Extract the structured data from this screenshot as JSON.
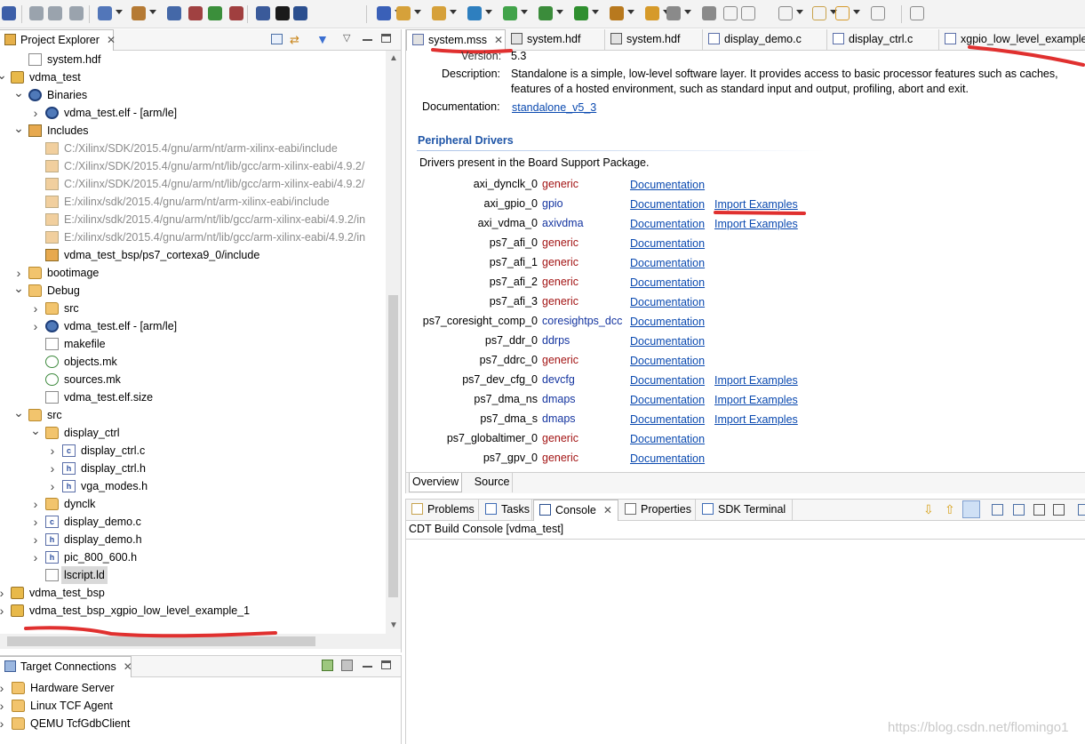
{
  "toolbar": {
    "icons": [
      "save-icon",
      "save-all-icon",
      "print-icon",
      "debug-config-icon",
      "build-icon",
      "hardware-icon",
      "program-fpga-icon",
      "xsct-icon",
      "launch-icon",
      "terminal-icon",
      "new-wizard-icon",
      "open-type-icon",
      "search-icon",
      "run-icon",
      "debug-icon",
      "external-tools-icon",
      "back-icon",
      "forward-icon",
      "open-perspective-icon"
    ]
  },
  "project_explorer": {
    "title": "Project Explorer",
    "rows": [
      {
        "label": "system.hdf",
        "indent": 1,
        "icon": "file",
        "twisty": ""
      },
      {
        "label": "vdma_test",
        "indent": 0,
        "icon": "project",
        "twisty": "open"
      },
      {
        "label": "Binaries",
        "indent": 1,
        "icon": "binaries",
        "twisty": "open"
      },
      {
        "label": "vdma_test.elf - [arm/le]",
        "indent": 2,
        "icon": "gear",
        "twisty": "closed"
      },
      {
        "label": "Includes",
        "indent": 1,
        "icon": "includes",
        "twisty": "open"
      },
      {
        "label": "C:/Xilinx/SDK/2015.4/gnu/arm/nt/arm-xilinx-eabi/include",
        "indent": 2,
        "icon": "include",
        "twisty": "",
        "grey": true
      },
      {
        "label": "C:/Xilinx/SDK/2015.4/gnu/arm/nt/lib/gcc/arm-xilinx-eabi/4.9.2/",
        "indent": 2,
        "icon": "include",
        "twisty": "",
        "grey": true
      },
      {
        "label": "C:/Xilinx/SDK/2015.4/gnu/arm/nt/lib/gcc/arm-xilinx-eabi/4.9.2/",
        "indent": 2,
        "icon": "include",
        "twisty": "",
        "grey": true
      },
      {
        "label": "E:/xilinx/sdk/2015.4/gnu/arm/nt/arm-xilinx-eabi/include",
        "indent": 2,
        "icon": "include",
        "twisty": "",
        "grey": true
      },
      {
        "label": "E:/xilinx/sdk/2015.4/gnu/arm/nt/lib/gcc/arm-xilinx-eabi/4.9.2/in",
        "indent": 2,
        "icon": "include",
        "twisty": "",
        "grey": true
      },
      {
        "label": "E:/xilinx/sdk/2015.4/gnu/arm/nt/lib/gcc/arm-xilinx-eabi/4.9.2/in",
        "indent": 2,
        "icon": "include",
        "twisty": "",
        "grey": true
      },
      {
        "label": "vdma_test_bsp/ps7_cortexa9_0/include",
        "indent": 2,
        "icon": "include2",
        "twisty": ""
      },
      {
        "label": "bootimage",
        "indent": 1,
        "icon": "folder",
        "twisty": "closed"
      },
      {
        "label": "Debug",
        "indent": 1,
        "icon": "folder",
        "twisty": "open"
      },
      {
        "label": "src",
        "indent": 2,
        "icon": "folder",
        "twisty": "closed"
      },
      {
        "label": "vdma_test.elf - [arm/le]",
        "indent": 2,
        "icon": "gear",
        "twisty": "closed"
      },
      {
        "label": "makefile",
        "indent": 2,
        "icon": "file",
        "twisty": ""
      },
      {
        "label": "objects.mk",
        "indent": 2,
        "icon": "mk",
        "twisty": ""
      },
      {
        "label": "sources.mk",
        "indent": 2,
        "icon": "mk",
        "twisty": ""
      },
      {
        "label": "vdma_test.elf.size",
        "indent": 2,
        "icon": "file",
        "twisty": ""
      },
      {
        "label": "src",
        "indent": 1,
        "icon": "folder",
        "twisty": "open"
      },
      {
        "label": "display_ctrl",
        "indent": 2,
        "icon": "folder",
        "twisty": "open"
      },
      {
        "label": "display_ctrl.c",
        "indent": 3,
        "icon": "c",
        "twisty": "closed"
      },
      {
        "label": "display_ctrl.h",
        "indent": 3,
        "icon": "h",
        "twisty": "closed"
      },
      {
        "label": "vga_modes.h",
        "indent": 3,
        "icon": "h",
        "twisty": "closed"
      },
      {
        "label": "dynclk",
        "indent": 2,
        "icon": "folder",
        "twisty": "closed"
      },
      {
        "label": "display_demo.c",
        "indent": 2,
        "icon": "c",
        "twisty": "closed"
      },
      {
        "label": "display_demo.h",
        "indent": 2,
        "icon": "h",
        "twisty": "closed"
      },
      {
        "label": "pic_800_600.h",
        "indent": 2,
        "icon": "h",
        "twisty": "closed"
      },
      {
        "label": "lscript.ld",
        "indent": 2,
        "icon": "ld",
        "twisty": "",
        "selected": true
      },
      {
        "label": "vdma_test_bsp",
        "indent": 0,
        "icon": "project",
        "twisty": "closed"
      },
      {
        "label": "vdma_test_bsp_xgpio_low_level_example_1",
        "indent": 0,
        "icon": "project",
        "twisty": "closed"
      }
    ]
  },
  "target_connections": {
    "title": "Target Connections",
    "rows": [
      "Hardware Server",
      "Linux TCF Agent",
      "QEMU TcfGdbClient"
    ]
  },
  "editor": {
    "tabs": [
      {
        "label": "system.mss",
        "active": true,
        "icon": "mss"
      },
      {
        "label": "system.hdf",
        "icon": "hdf"
      },
      {
        "label": "system.hdf",
        "icon": "hdf"
      },
      {
        "label": "display_demo.c",
        "icon": "c"
      },
      {
        "label": "display_ctrl.c",
        "icon": "c"
      },
      {
        "label": "xgpio_low_level_example",
        "icon": "c"
      }
    ],
    "version_label": "Version:",
    "version_value": "5.3",
    "description_label": "Description:",
    "description_line1": "Standalone is a simple, low-level software layer. It provides access to basic processor features such as caches,",
    "description_line2": "features of a hosted environment, such as standard input and output, profiling, abort and exit.",
    "documentation_label": "Documentation:",
    "documentation_link": "standalone_v5_3",
    "section_title": "Peripheral Drivers",
    "section_desc": "Drivers present in the Board Support Package.",
    "drivers": [
      {
        "name": "axi_dynclk_0",
        "driver": "generic",
        "kind": "generic",
        "doc": "Documentation",
        "examples": ""
      },
      {
        "name": "axi_gpio_0",
        "driver": "gpio",
        "kind": "blue",
        "doc": "Documentation",
        "examples": "Import Examples"
      },
      {
        "name": "axi_vdma_0",
        "driver": "axivdma",
        "kind": "blue",
        "doc": "Documentation",
        "examples": "Import Examples"
      },
      {
        "name": "ps7_afi_0",
        "driver": "generic",
        "kind": "generic",
        "doc": "Documentation",
        "examples": ""
      },
      {
        "name": "ps7_afi_1",
        "driver": "generic",
        "kind": "generic",
        "doc": "Documentation",
        "examples": ""
      },
      {
        "name": "ps7_afi_2",
        "driver": "generic",
        "kind": "generic",
        "doc": "Documentation",
        "examples": ""
      },
      {
        "name": "ps7_afi_3",
        "driver": "generic",
        "kind": "generic",
        "doc": "Documentation",
        "examples": ""
      },
      {
        "name": "ps7_coresight_comp_0",
        "driver": "coresightps_dcc",
        "kind": "blue",
        "doc": "Documentation",
        "examples": ""
      },
      {
        "name": "ps7_ddr_0",
        "driver": "ddrps",
        "kind": "blue",
        "doc": "Documentation",
        "examples": ""
      },
      {
        "name": "ps7_ddrc_0",
        "driver": "generic",
        "kind": "generic",
        "doc": "Documentation",
        "examples": ""
      },
      {
        "name": "ps7_dev_cfg_0",
        "driver": "devcfg",
        "kind": "blue",
        "doc": "Documentation",
        "examples": "Import Examples"
      },
      {
        "name": "ps7_dma_ns",
        "driver": "dmaps",
        "kind": "blue",
        "doc": "Documentation",
        "examples": "Import Examples"
      },
      {
        "name": "ps7_dma_s",
        "driver": "dmaps",
        "kind": "blue",
        "doc": "Documentation",
        "examples": "Import Examples"
      },
      {
        "name": "ps7_globaltimer_0",
        "driver": "generic",
        "kind": "generic",
        "doc": "Documentation",
        "examples": ""
      },
      {
        "name": "ps7_gpv_0",
        "driver": "generic",
        "kind": "generic",
        "doc": "Documentation",
        "examples": ""
      }
    ],
    "bottom_tabs": [
      {
        "label": "Overview",
        "active": true
      },
      {
        "label": "Source",
        "active": false
      }
    ]
  },
  "console": {
    "tabs": [
      {
        "label": "Problems",
        "active": false
      },
      {
        "label": "Tasks",
        "active": false
      },
      {
        "label": "Console",
        "active": true
      },
      {
        "label": "Properties",
        "active": false
      },
      {
        "label": "SDK Terminal",
        "active": false
      }
    ],
    "header": "CDT Build Console [vdma_test]"
  },
  "watermark": "https://blog.csdn.net/flomingo1"
}
